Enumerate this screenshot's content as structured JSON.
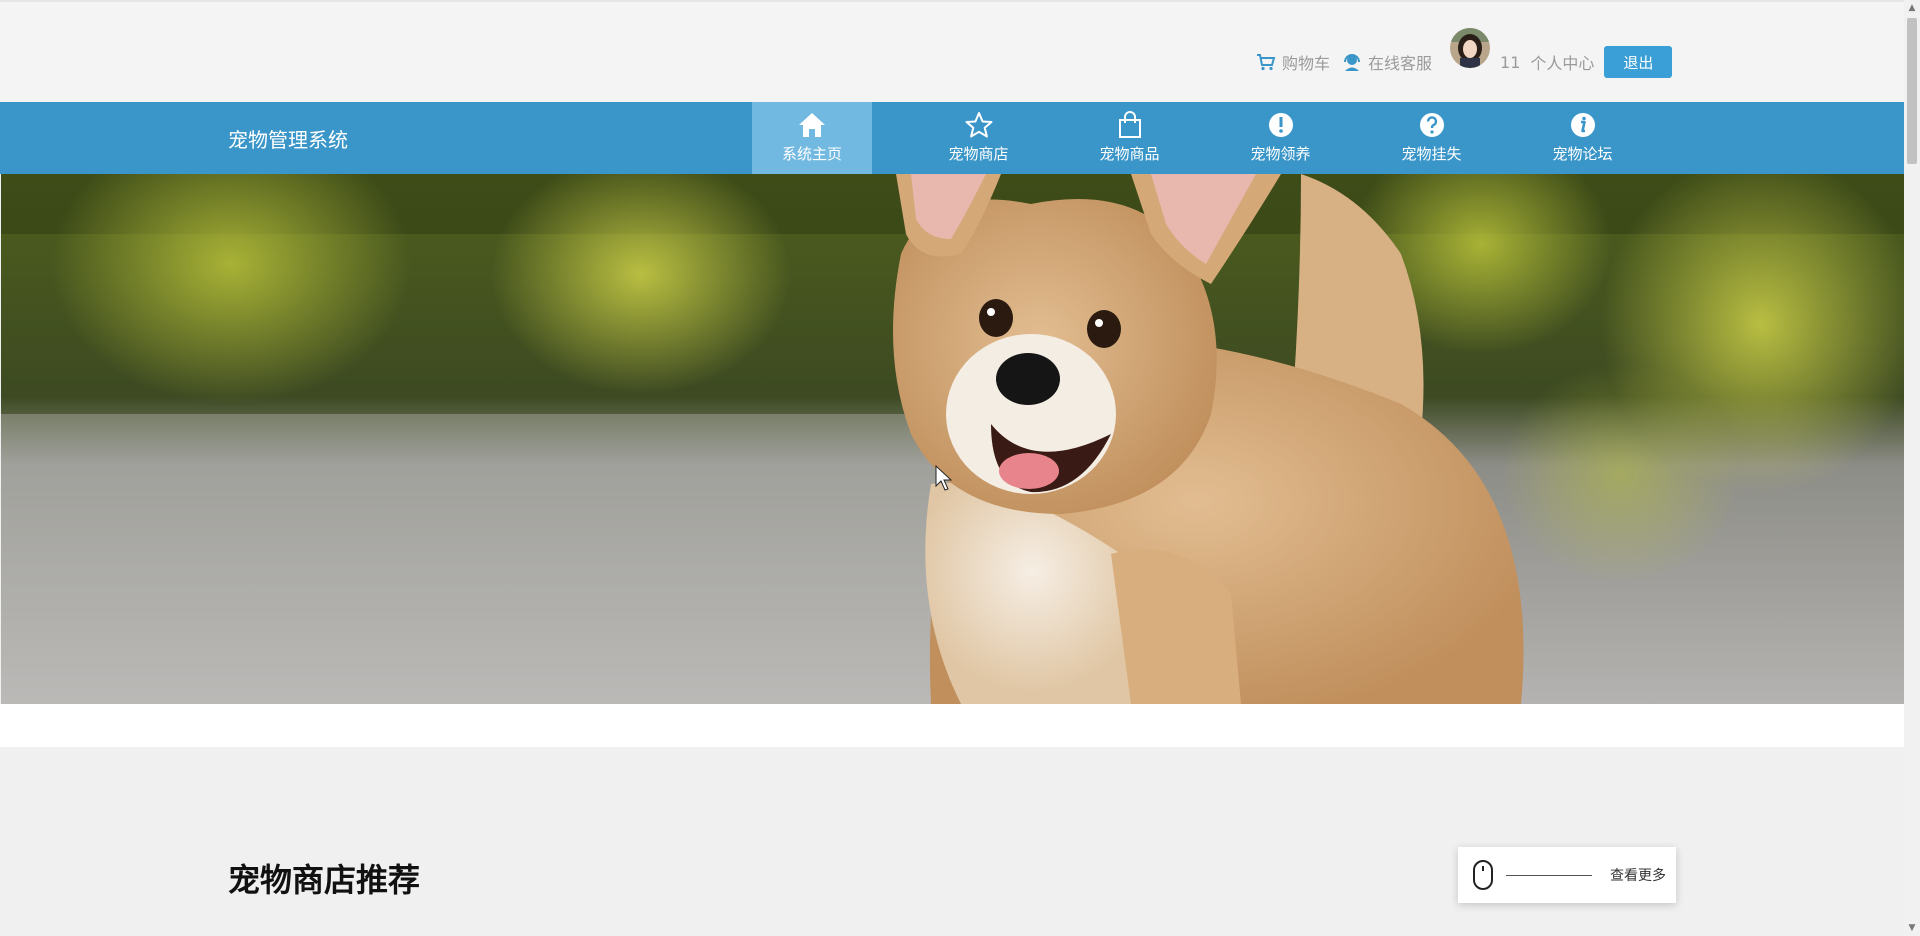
{
  "top_bar": {
    "cart_label": "购物车",
    "service_label": "在线客服",
    "username": "11",
    "personal_center": "个人中心",
    "logout_label": "退出"
  },
  "nav": {
    "brand": "宠物管理系统",
    "items": [
      {
        "label": "系统主页",
        "icon": "home-icon"
      },
      {
        "label": "宠物商店",
        "icon": "star-icon"
      },
      {
        "label": "宠物商品",
        "icon": "shopping-bag-icon"
      },
      {
        "label": "宠物领养",
        "icon": "exclamation-icon"
      },
      {
        "label": "宠物挂失",
        "icon": "question-icon"
      },
      {
        "label": "宠物论坛",
        "icon": "info-icon"
      }
    ],
    "active_index": 0
  },
  "section": {
    "title": "宠物商店推荐",
    "more_label": "查看更多"
  },
  "colors": {
    "nav_bg": "#3a96c8",
    "nav_active": "#72b9e1",
    "accent_button": "#3a9fd6"
  }
}
